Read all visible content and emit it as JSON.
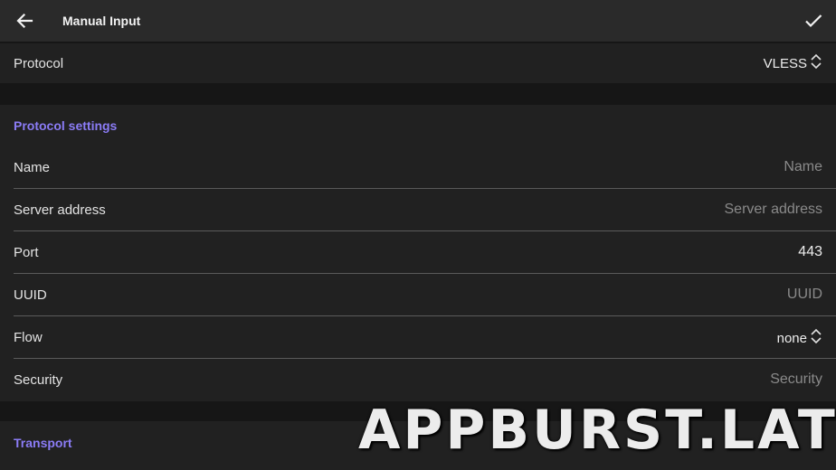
{
  "app_bar": {
    "title": "Manual Input",
    "back_icon": "arrow-left-icon",
    "confirm_icon": "check-icon"
  },
  "protocol": {
    "label": "Protocol",
    "value": "VLESS",
    "icon": "chevron-up-down-icon"
  },
  "protocol_settings": {
    "title": "Protocol settings",
    "fields": {
      "name": {
        "label": "Name",
        "placeholder": "Name"
      },
      "server_address": {
        "label": "Server address",
        "placeholder": "Server address"
      },
      "port": {
        "label": "Port",
        "value": "443"
      },
      "uuid": {
        "label": "UUID",
        "placeholder": "UUID"
      },
      "flow": {
        "label": "Flow",
        "value": "none"
      },
      "security": {
        "label": "Security",
        "placeholder": "Security"
      }
    }
  },
  "transport": {
    "title": "Transport"
  },
  "watermark": "APPBURST.LAT",
  "colors": {
    "accent": "#8b7cf6",
    "background": "#161616",
    "card": "#212121",
    "app_bar": "#2a2a2a",
    "divider": "#5a5a5a"
  }
}
